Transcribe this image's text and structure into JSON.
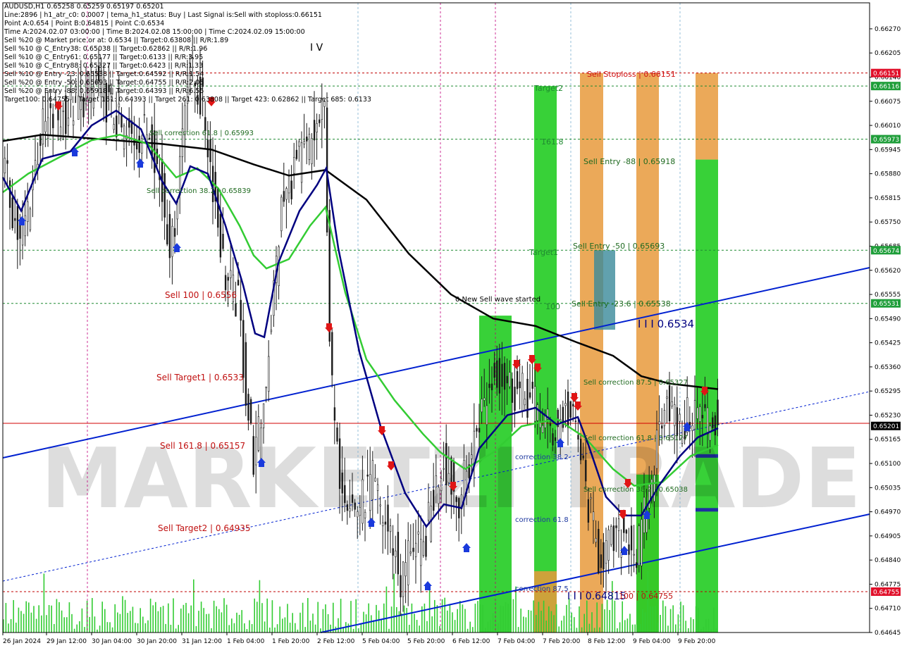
{
  "info_lines": [
    "AUDUSD,H1  0.65258 0.65259 0.65197 0.65201",
    "Line:2896 | h1_atr_c0: 0.0007 | tema_h1_status: Buy | Last Signal is:Sell with stoploss:0.66151",
    "Point A:0.654 | Point B:0.64815 | Point C:0.6534",
    "Time A:2024.02.07 03:00:00 | Time B:2024.02.08 15:00:00 | Time C:2024.02.09 15:00:00",
    "Sell %20 @ Market price or at: 0.6534 || Target:0.63808 || R/R:1.89",
    "Sell %10 @ C_Entry38: 0.65038 || Target:0.62862 || R/R:1.96",
    "Sell %10 @ C_Entry61: 0.65177 || Target:0.6133 || R/R:3.95",
    "Sell %10 @ C_Entry88: 0.65327 || Target:0.6423 || R/R:1.33",
    "Sell %10 @ Entry -23: 0.65538 || Target:0.64592 || R/R:1.54",
    "Sell %20 @ Entry -50: 0.65693 || Target:0.64755 || R/R:2.05",
    "Sell %20 @ Entry -88: 0.65918 || Target:0.64393 || R/R:6.55",
    "Target100: 0.64755 || Target 161: 0.64393 || Target 261: 0.63808 || Target 423: 0.62862 || Target 685: 0.6133"
  ],
  "chart_data": {
    "type": "candlestick",
    "symbol": "AUDUSD,H1",
    "ylim": [
      0.64645,
      0.6634
    ],
    "y_ticks": [
      "0.66270",
      "0.66205",
      "0.66140",
      "0.66075",
      "0.66010",
      "0.65945",
      "0.65880",
      "0.65815",
      "0.65750",
      "0.65685",
      "0.65620",
      "0.65555",
      "0.65490",
      "0.65425",
      "0.65360",
      "0.65295",
      "0.65230",
      "0.65165",
      "0.65100",
      "0.65035",
      "0.64970",
      "0.64905",
      "0.64840",
      "0.64775",
      "0.64710",
      "0.64645"
    ],
    "x_ticks": [
      "26 Jan 2024",
      "29 Jan 12:00",
      "30 Jan 04:00",
      "30 Jan 20:00",
      "31 Jan 12:00",
      "1 Feb 04:00",
      "1 Feb 20:00",
      "2 Feb 12:00",
      "5 Feb 04:00",
      "5 Feb 20:00",
      "6 Feb 12:00",
      "7 Feb 04:00",
      "7 Feb 20:00",
      "8 Feb 12:00",
      "9 Feb 04:00",
      "9 Feb 20:00"
    ],
    "price_tags": [
      {
        "label": "0.66151",
        "value": 0.66151,
        "color": "#e0102a"
      },
      {
        "label": "0.66116",
        "value": 0.66116,
        "color": "#1f9e3a"
      },
      {
        "label": "0.65973",
        "value": 0.65973,
        "color": "#1f9e3a"
      },
      {
        "label": "0.65674",
        "value": 0.65674,
        "color": "#1f9e3a"
      },
      {
        "label": "0.65531",
        "value": 0.65531,
        "color": "#1f9e3a"
      },
      {
        "label": "0.65201",
        "value": 0.65201,
        "color": "#000000"
      },
      {
        "label": "0.64755",
        "value": 0.64755,
        "color": "#e0102a"
      }
    ],
    "hlines": [
      {
        "value": 0.66151,
        "color": "#c00000",
        "dash": "3,3"
      },
      {
        "value": 0.66116,
        "color": "#1f8a30",
        "dash": "3,3"
      },
      {
        "value": 0.65973,
        "color": "#1f8a30",
        "dash": "3,3"
      },
      {
        "value": 0.65674,
        "color": "#1f8a30",
        "dash": "3,3"
      },
      {
        "value": 0.65531,
        "color": "#1f8a30",
        "dash": "3,3"
      },
      {
        "value": 0.65208,
        "color": "#d00000",
        "dash": ""
      },
      {
        "value": 0.64755,
        "color": "#c00000",
        "dash": "3,3"
      }
    ],
    "labels": [
      {
        "text": "Sell Stoploss | 0.66151",
        "color": "#d01010"
      },
      {
        "text": "Target2",
        "color": "#1f8a30"
      },
      {
        "text": "161.8",
        "color": "#1f8a30"
      },
      {
        "text": "Sell Entry -88 | 0.65918",
        "color": "#1f6a20"
      },
      {
        "text": "Sell Entry -50 | 0.65693",
        "color": "#1f6a20"
      },
      {
        "text": "Target1",
        "color": "#1f8a30"
      },
      {
        "text": "Sell Entry -23.6 | 0.65538",
        "color": "#1f6a20"
      },
      {
        "text": "100",
        "color": "#1f8a30"
      },
      {
        "text": "0 New Sell wave started",
        "color": "#000000"
      },
      {
        "text": "I I I 0.6534",
        "color": "#000080"
      },
      {
        "text": "Sell correction 87.5 | 0.65327",
        "color": "#1f6a20"
      },
      {
        "text": "Sell correction 61.8 | 0.65177",
        "color": "#1f6a20"
      },
      {
        "text": "Sell correction 38.2 | 0.65038",
        "color": "#1f6a20"
      },
      {
        "text": "correction 38.2",
        "color": "#1f3aa0"
      },
      {
        "text": "correction 61.8",
        "color": "#1f3aa0"
      },
      {
        "text": "correction 87.5",
        "color": "#1f3aa0"
      },
      {
        "text": "I I I 0.64815",
        "color": "#000080"
      },
      {
        "text": "100 | 0.64755",
        "color": "#c01010"
      },
      {
        "text": "Sell correction 61.8 | 0.65993",
        "color": "#1f6a20"
      },
      {
        "text": "Sell correction 38.2 | 0.65839",
        "color": "#1f6a20"
      },
      {
        "text": "Sell 100 | 0.6556",
        "color": "#c01010"
      },
      {
        "text": "Sell Target1 | 0.6533",
        "color": "#c01010"
      },
      {
        "text": "Sell 161.8 | 0.65157",
        "color": "#c01010"
      },
      {
        "text": "Sell Target2 | 0.64935",
        "color": "#c01010"
      },
      {
        "text": "I V",
        "color": "#000000"
      }
    ],
    "watermark": "MARKETZI TRADE",
    "colors": {
      "bull": "#1a1a1a",
      "bear": "#1a1a1a",
      "ema_black": "#000000",
      "ema_green": "#33cc33",
      "tema_blue": "#000080",
      "channel": "#0020d0",
      "volume": "#33cc33",
      "target_green": "#22cc22",
      "entry_orange": "#e89a3c"
    }
  }
}
